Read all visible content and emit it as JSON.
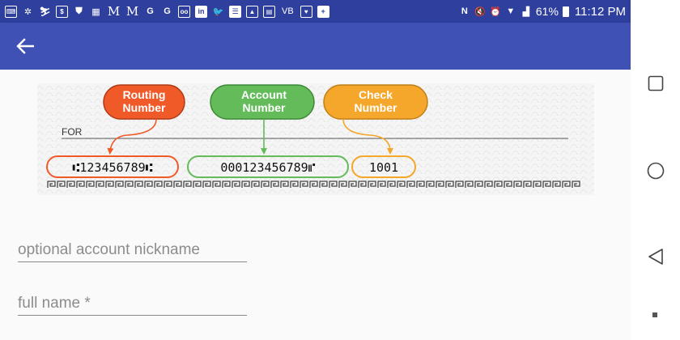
{
  "status_bar": {
    "left_icons": [
      {
        "name": "keyboard-icon",
        "glyph": "⌨",
        "style": "box"
      },
      {
        "name": "weather-icon",
        "glyph": "✲",
        "style": ""
      },
      {
        "name": "hiker-icon",
        "glyph": "⛷",
        "style": ""
      },
      {
        "name": "pay-icon",
        "glyph": "$",
        "style": "box"
      },
      {
        "name": "shield-icon",
        "glyph": "⛊",
        "style": ""
      },
      {
        "name": "calculator-icon",
        "glyph": "▦",
        "style": ""
      },
      {
        "name": "gmail-icon",
        "glyph": "M",
        "style": "serif"
      },
      {
        "name": "gmail-icon-2",
        "glyph": "M",
        "style": "serif"
      },
      {
        "name": "google-icon",
        "glyph": "G",
        "style": ""
      },
      {
        "name": "google-icon-2",
        "glyph": "G",
        "style": ""
      },
      {
        "name": "voicemail-icon",
        "glyph": "oo",
        "style": "box"
      },
      {
        "name": "linkedin-icon",
        "glyph": "in",
        "style": "filled"
      },
      {
        "name": "twitter-icon",
        "glyph": "🐦",
        "style": ""
      },
      {
        "name": "notes-icon",
        "glyph": "☰",
        "style": "filled"
      },
      {
        "name": "photo-icon",
        "glyph": "▲",
        "style": "box"
      },
      {
        "name": "news-icon",
        "glyph": "▤",
        "style": "box"
      },
      {
        "name": "vb-label",
        "glyph": "VB",
        "style": "text"
      },
      {
        "name": "health-icon",
        "glyph": "♥",
        "style": "box"
      },
      {
        "name": "battery-saver-icon",
        "glyph": "+",
        "style": "filled"
      }
    ],
    "right_icons": [
      {
        "name": "nfc-icon",
        "glyph": "N"
      },
      {
        "name": "mute-icon",
        "glyph": "🔇"
      },
      {
        "name": "alarm-icon",
        "glyph": "⏰"
      },
      {
        "name": "wifi-icon",
        "glyph": "▼"
      },
      {
        "name": "signal-icon",
        "glyph": "▟"
      }
    ],
    "battery_percent": "61%",
    "time": "11:12 PM"
  },
  "app_bar": {
    "back_icon": "arrow-left-icon"
  },
  "check_image": {
    "labels": {
      "routing": [
        "Routing",
        "Number"
      ],
      "account": [
        "Account",
        "Number"
      ],
      "check": [
        "Check",
        "Number"
      ]
    },
    "for_label": "FOR",
    "routing_digits": "⑆123456789⑆",
    "account_digits": "000123456789⑈",
    "check_digits": "1001",
    "colors": {
      "routing": "#ef5a28",
      "account": "#63bb5a",
      "check": "#f4a72b"
    }
  },
  "form": {
    "nickname_placeholder": "optional account nickname",
    "fullname_placeholder": "full name *"
  },
  "nav_bar": {
    "recents_icon": "square-icon",
    "home_icon": "circle-icon",
    "back_icon": "triangle-back-icon"
  }
}
